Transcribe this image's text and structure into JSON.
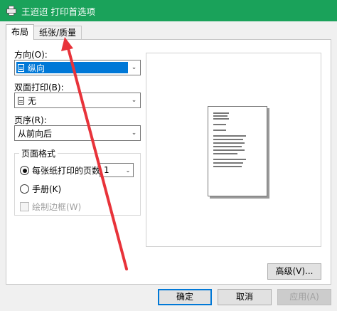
{
  "window": {
    "title": "王迢迢 打印首选项",
    "icon": "printer-icon"
  },
  "tabs": [
    {
      "label": "布局",
      "active": true
    },
    {
      "label": "纸张/质量",
      "active": false
    }
  ],
  "orientation": {
    "label": "方向(O):",
    "value": "纵向",
    "icon": "portrait-page-icon"
  },
  "duplex": {
    "label": "双面打印(B):",
    "value": "无",
    "icon": "document-icon"
  },
  "page_order": {
    "label": "页序(R):",
    "value": "从前向后"
  },
  "page_format": {
    "group_title": "页面格式",
    "pages_per_sheet": {
      "label": "每张纸打印的页数(S)",
      "value": "1",
      "selected": true
    },
    "booklet": {
      "label": "手册(K)",
      "selected": false
    },
    "draw_borders": {
      "label": "绘制边框(W)",
      "checked": false,
      "enabled": false
    }
  },
  "buttons": {
    "advanced": "高级(V)...",
    "ok": "确定",
    "cancel": "取消",
    "apply": "应用(A)"
  },
  "annotation": {
    "type": "red-arrow",
    "color": "#e8333a",
    "points_to": "纸张/质量"
  }
}
